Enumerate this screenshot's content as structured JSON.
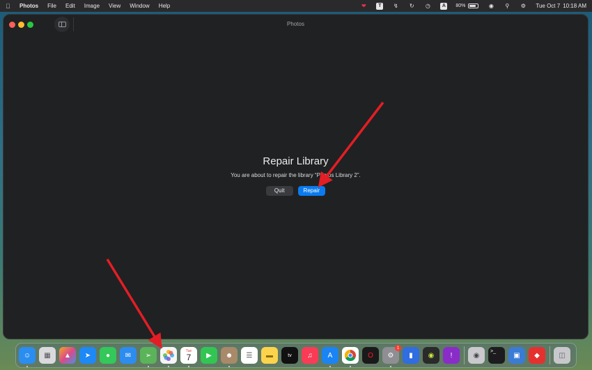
{
  "menubar": {
    "app_name": "Photos",
    "items": [
      "File",
      "Edit",
      "Image",
      "View",
      "Window",
      "Help"
    ],
    "status_icons": [
      "heart-icon",
      "text-icon",
      "bolt-icon",
      "r-icon",
      "clock-icon",
      "a-icon"
    ],
    "a_label": "A",
    "t_label": "T",
    "battery_text": "80%",
    "battery_level": 0.8,
    "date": "Tue Oct 7",
    "time": "10:18 AM"
  },
  "window": {
    "title": "Photos"
  },
  "dialog": {
    "heading": "Repair Library",
    "message": "You are about to repair the library “Photos Library 2”.",
    "quit_label": "Quit",
    "repair_label": "Repair"
  },
  "dock": {
    "calendar_month": "Tue",
    "calendar_day": "7",
    "appletv_label": "tv",
    "terminal_label": ">_",
    "settings_badge": "1",
    "apps": [
      {
        "name": "finder-icon",
        "color": "#2a8df0"
      },
      {
        "name": "launchpad-icon",
        "color": "#d9d9de"
      },
      {
        "name": "affinity-photo-icon",
        "color": "#d94a8a"
      },
      {
        "name": "safari-icon",
        "color": "#1e88f5"
      },
      {
        "name": "messages-icon",
        "color": "#34c759"
      },
      {
        "name": "mail-icon",
        "color": "#2d8cf0"
      },
      {
        "name": "maps-icon",
        "color": "#5bb35a"
      },
      {
        "name": "photos-icon",
        "color": "#f5f5f5"
      },
      {
        "name": "calendar-icon",
        "color": "#ffffff"
      },
      {
        "name": "facetime-icon",
        "color": "#32c553"
      },
      {
        "name": "contacts-icon",
        "color": "#a8896a"
      },
      {
        "name": "reminders-icon",
        "color": "#ffffff"
      },
      {
        "name": "notes-icon",
        "color": "#fcd34d"
      },
      {
        "name": "apple-tv-icon",
        "color": "#111111"
      },
      {
        "name": "music-icon",
        "color": "#fa3b56"
      },
      {
        "name": "app-store-icon",
        "color": "#1a84f5"
      },
      {
        "name": "chrome-icon",
        "color": "#ffffff"
      },
      {
        "name": "opera-icon",
        "color": "#1a1a1a"
      },
      {
        "name": "system-settings-icon",
        "color": "#8e8e93"
      },
      {
        "name": "gatekeeper-icon",
        "color": "#2f6de0"
      },
      {
        "name": "silverlock-icon",
        "color": "#2a2a2a"
      },
      {
        "name": "feedback-icon",
        "color": "#8a2cc8"
      },
      {
        "name": "disk-utility-icon",
        "color": "#c9c9ce"
      },
      {
        "name": "terminal-icon",
        "color": "#1c1c1e"
      },
      {
        "name": "migration-assistant-icon",
        "color": "#3a7bd5"
      },
      {
        "name": "anydesk-icon",
        "color": "#e5312e"
      },
      {
        "name": "trash-icon",
        "color": "#c7c7cc"
      }
    ]
  },
  "colors": {
    "accent": "#0a7bf0",
    "annotation_arrow": "#e31e24"
  }
}
